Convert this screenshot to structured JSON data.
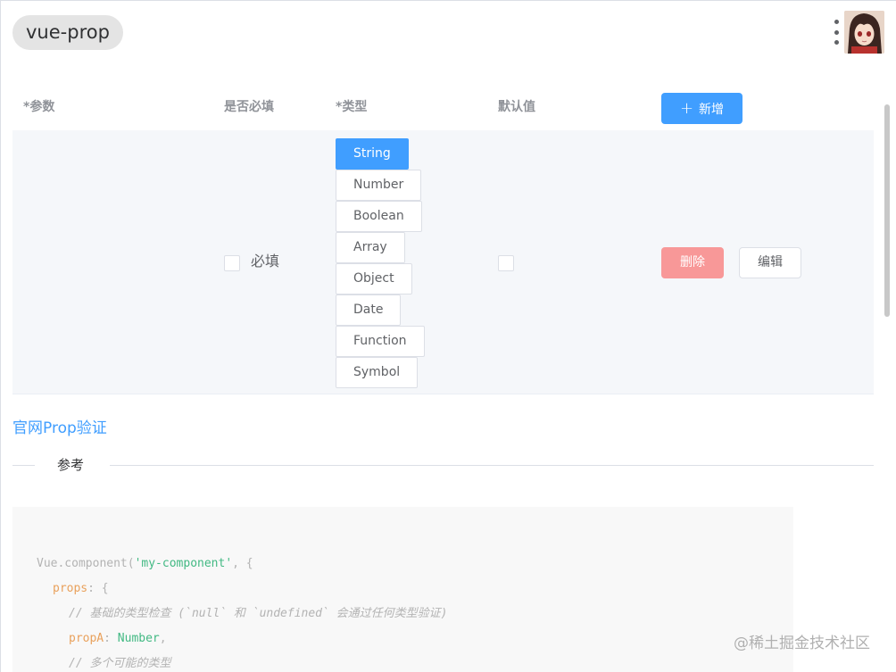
{
  "header": {
    "title": "vue-prop"
  },
  "table": {
    "headers": {
      "param": "*参数",
      "required": "是否必填",
      "type": "*类型",
      "default": "默认值"
    },
    "add_button": "新增",
    "row": {
      "required_label": "必填",
      "types": [
        "String",
        "Number",
        "Boolean",
        "Array",
        "Object",
        "Date",
        "Function",
        "Symbol"
      ],
      "selected_type": "String",
      "delete_button": "删除",
      "edit_button": "编辑"
    }
  },
  "link": {
    "text": "官网Prop验证"
  },
  "divider": {
    "text": "参考"
  },
  "code": {
    "line1_a": "Vue.component(",
    "line1_b": "'my-component'",
    "line1_c": ", {",
    "line2_a": "props",
    "line2_b": ": {",
    "line3": "// 基础的类型检查 (`null` 和 `undefined` 会通过任何类型验证)",
    "line4_a": "propA",
    "line4_b": ": ",
    "line4_c": "Number",
    "line4_d": ",",
    "line5": "// 多个可能的类型"
  },
  "watermark": "@稀土掘金技术社区",
  "colors": {
    "primary": "#409eff",
    "danger_light": "#f89898",
    "row_bg": "#f5f7fa"
  }
}
